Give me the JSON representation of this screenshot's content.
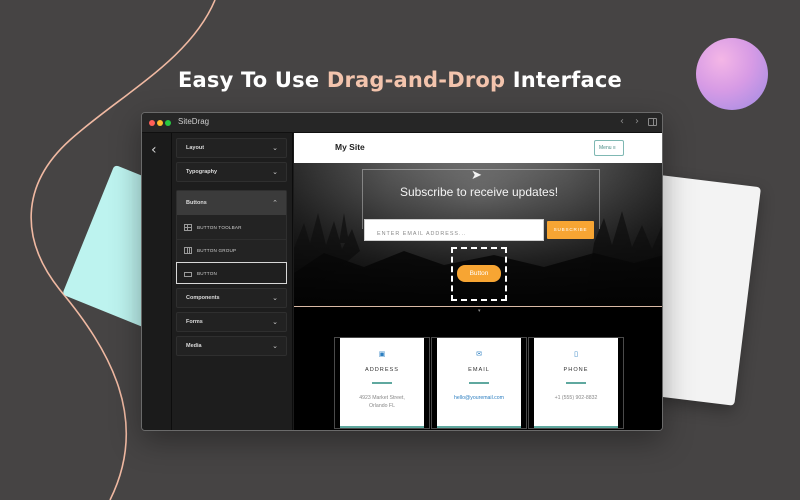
{
  "headline": {
    "prefix": "Easy To Use ",
    "accent": "Drag-and-Drop",
    "suffix": " Interface"
  },
  "colors": {
    "accent": "#f3c4ad",
    "button": "#f7a533",
    "teal": "#5fa89f",
    "link": "#2d7fc1",
    "background": "#464444"
  },
  "window": {
    "title": "SiteDrag",
    "toolbar_icons": [
      "chevron-left-icon",
      "chevron-right-icon",
      "sidebar-toggle-icon"
    ]
  },
  "panel": {
    "accordions": [
      {
        "label": "Layout",
        "expanded": false
      },
      {
        "label": "Typography",
        "expanded": false
      },
      {
        "label": "Buttons",
        "expanded": true
      },
      {
        "label": "Components",
        "expanded": false
      },
      {
        "label": "Forms",
        "expanded": false
      },
      {
        "label": "Media",
        "expanded": false
      }
    ],
    "button_items": [
      {
        "label": "BUTTON TOOLBAR",
        "icon": "grid-icon"
      },
      {
        "label": "BUTTON GROUP",
        "icon": "columns-icon"
      },
      {
        "label": "BUTTON",
        "icon": "button-icon",
        "selected": true
      }
    ]
  },
  "site": {
    "title": "My Site",
    "menu_label": "Menu ≡",
    "hero": {
      "title": "Subscribe to receive updates!",
      "email_placeholder": "ENTER EMAIL ADDRESS...",
      "subscribe_label": "SUBSCRIBE",
      "button_label": "Button"
    },
    "contacts": [
      {
        "icon": "building-icon",
        "title": "ADDRESS",
        "text": "4923 Market Street, Orlando FL",
        "link": false
      },
      {
        "icon": "envelope-icon",
        "title": "EMAIL",
        "text": "hello@youremail.com",
        "link": true
      },
      {
        "icon": "phone-icon",
        "title": "PHONE",
        "text": "+1 (555) 902-8832",
        "link": false
      }
    ]
  }
}
